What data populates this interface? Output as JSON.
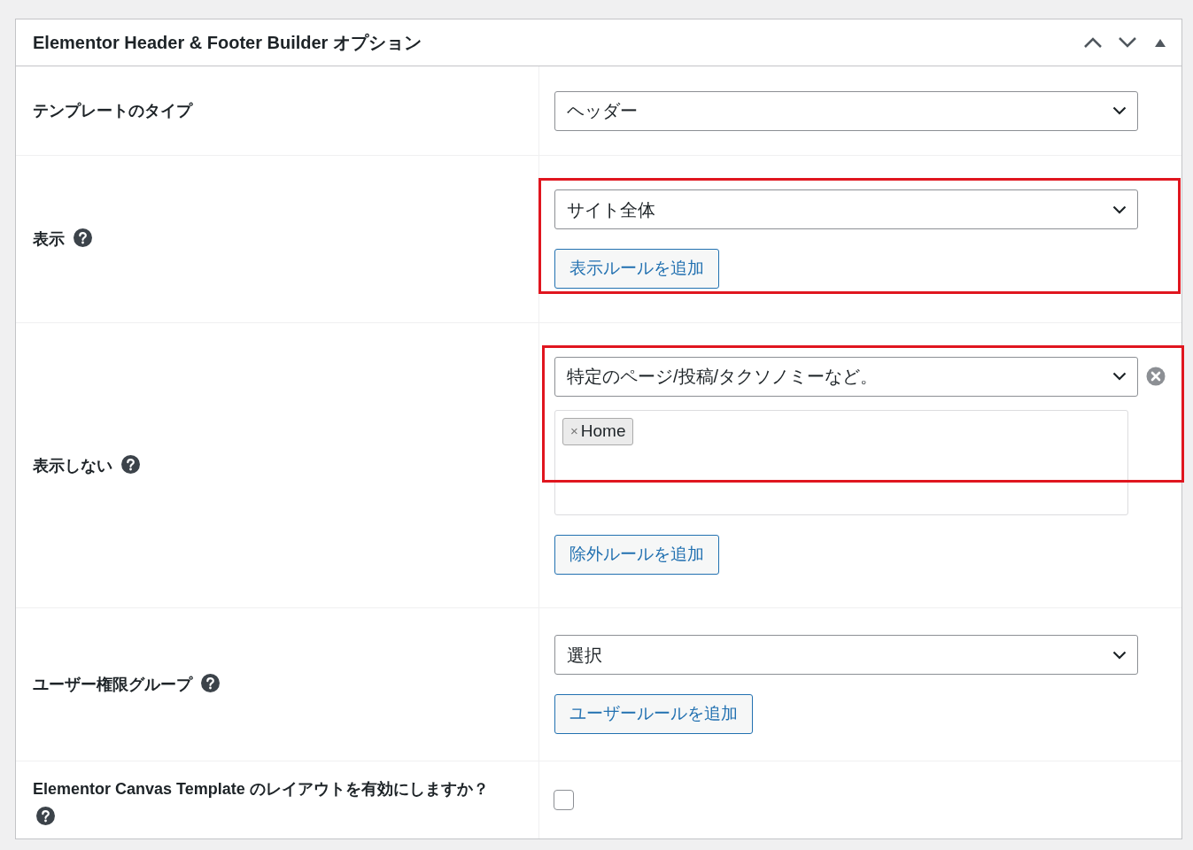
{
  "panel": {
    "title": "Elementor Header & Footer Builder オプション"
  },
  "rows": [
    {
      "kind": "select",
      "label": "テンプレートのタイプ",
      "help": false,
      "highlighted": false,
      "select": {
        "value": "ヘッダー",
        "removable": false
      }
    },
    {
      "kind": "select",
      "label": "表示",
      "help": true,
      "highlighted": true,
      "select": {
        "value": "サイト全体",
        "removable": false
      },
      "button": "表示ルールを追加"
    },
    {
      "kind": "select",
      "label": "表示しない",
      "help": true,
      "highlighted": true,
      "select": {
        "value": "特定のページ/投稿/タクソノミーなど。",
        "removable": true
      },
      "tags": [
        {
          "remove": "×",
          "label": "Home"
        }
      ],
      "button": "除外ルールを追加"
    },
    {
      "kind": "select",
      "label": "ユーザー権限グループ",
      "help": true,
      "highlighted": false,
      "select": {
        "value": "選択",
        "removable": false
      },
      "button": "ユーザールールを追加"
    },
    {
      "kind": "checkbox",
      "label": "Elementor Canvas Template のレイアウトを有効にしますか？",
      "help": true,
      "checked": false
    }
  ]
}
